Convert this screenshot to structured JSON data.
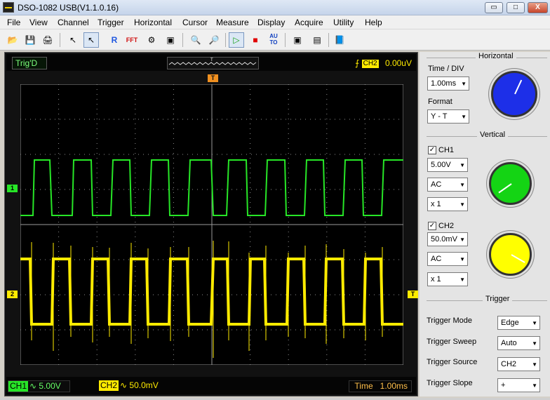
{
  "window": {
    "title": "DSO-1082 USB(V1.1.0.16)",
    "minimize": "▭",
    "maximize": "□",
    "close": "X"
  },
  "menu": [
    "File",
    "View",
    "Channel",
    "Trigger",
    "Horizontal",
    "Cursor",
    "Measure",
    "Display",
    "Acquire",
    "Utility",
    "Help"
  ],
  "toolbar": {
    "icons": [
      "open-icon",
      "save-icon",
      "print-icon",
      "cursor-select-icon",
      "pointer-icon",
      "reference-icon",
      "fft-icon",
      "scope-icon",
      "picture-icon",
      "zoom-in-icon",
      "zoom-out-icon",
      "run-icon",
      "stop-icon",
      "auto-icon",
      "capture-icon",
      "settings-icon",
      "book-icon"
    ],
    "texts": {
      "R": "R",
      "FFT": "FFT",
      "AUTO": "AU\nTO"
    }
  },
  "scope": {
    "trig_status": "Trig'D",
    "trigger_channel": "CH2",
    "trigger_level": "0.00uV",
    "markers": {
      "ch1": "1",
      "ch2": "2",
      "top": "T",
      "right": "T"
    },
    "ch1": {
      "name": "CH1",
      "scale": "5.00V",
      "coupling_symbol": "∿"
    },
    "ch2": {
      "name": "CH2",
      "scale": "50.0mV",
      "coupling_symbol": "∿"
    },
    "time": {
      "label": "Time",
      "value": "1.00ms"
    },
    "colors": {
      "ch1": "#27e627",
      "ch2": "#ffeb00",
      "grid": "#8f8f8f",
      "background": "#000000"
    }
  },
  "panel": {
    "horizontal": {
      "title": "Horizontal",
      "time_div_label": "Time / DIV",
      "time_div_value": "1.00ms",
      "format_label": "Format",
      "format_value": "Y - T"
    },
    "vertical": {
      "title": "Vertical",
      "ch1": {
        "label": "CH1",
        "checked": true,
        "volts_div": "5.00V",
        "coupling": "AC",
        "probe": "x 1",
        "knob_color": "#14d414"
      },
      "ch2": {
        "label": "CH2",
        "checked": true,
        "volts_div": "50.0mV",
        "coupling": "AC",
        "probe": "x 1",
        "knob_color": "#ffff00"
      }
    },
    "trigger": {
      "title": "Trigger",
      "mode_label": "Trigger Mode",
      "mode_value": "Edge",
      "sweep_label": "Trigger Sweep",
      "sweep_value": "Auto",
      "source_label": "Trigger Source",
      "source_value": "CH2",
      "slope_label": "Trigger Slope",
      "slope_value": "+"
    },
    "knob_colors": {
      "horizontal": "#1d2fe8"
    }
  }
}
